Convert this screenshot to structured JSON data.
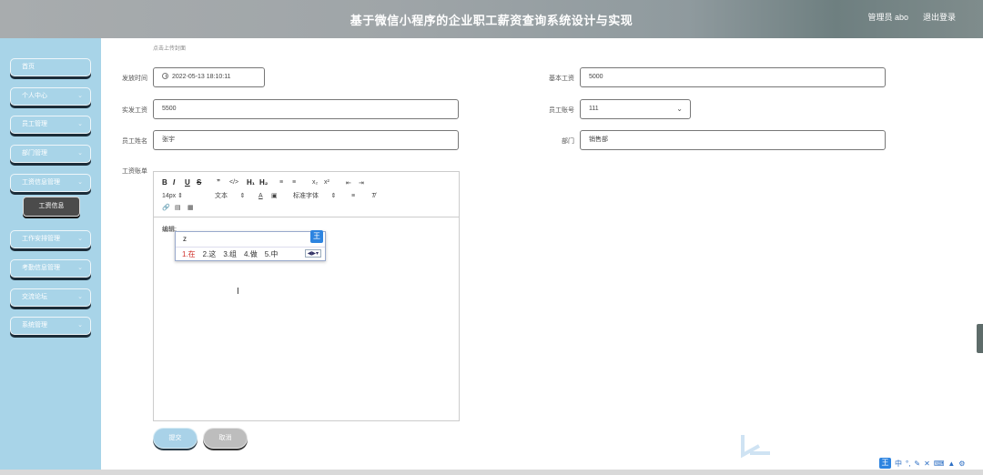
{
  "header": {
    "title": "基于微信小程序的企业职工薪资查询系统设计与实现",
    "admin_label": "管理员 abo",
    "logout_label": "退出登录"
  },
  "sidebar": {
    "items": [
      {
        "label": "首页",
        "has_chevron": false
      },
      {
        "label": "个人中心",
        "has_chevron": true
      },
      {
        "label": "员工管理",
        "has_chevron": true
      },
      {
        "label": "部门管理",
        "has_chevron": true
      },
      {
        "label": "工资信息管理",
        "has_chevron": true
      },
      {
        "label": "工作安排管理",
        "has_chevron": true
      },
      {
        "label": "考勤信息管理",
        "has_chevron": true
      },
      {
        "label": "交流论坛",
        "has_chevron": true
      },
      {
        "label": "系统管理",
        "has_chevron": true
      }
    ],
    "submenu": {
      "label": "工资信息"
    }
  },
  "form": {
    "upload_hint": "点击上传封面",
    "issue_time": {
      "label": "发放时间",
      "value": "2022-05-13 18:10:11"
    },
    "base_salary": {
      "label": "基本工资",
      "value": "5000"
    },
    "actual_salary": {
      "label": "实发工资",
      "value": "5500"
    },
    "employee_account": {
      "label": "员工账号",
      "value": "111"
    },
    "employee_name": {
      "label": "员工姓名",
      "value": "张宇"
    },
    "department": {
      "label": "部门",
      "value": "销售部"
    },
    "salary_detail": {
      "label": "工资账单"
    }
  },
  "editor": {
    "font_size": "14px",
    "paragraph": "文本",
    "font_family": "标准字体",
    "content": "编辑:"
  },
  "ime": {
    "composition": "z",
    "badge": "王",
    "candidates": [
      "1.在",
      "2.这",
      "3.组",
      "4.做",
      "5.中"
    ]
  },
  "buttons": {
    "submit": "提交",
    "cancel": "取消"
  },
  "tray": {
    "badge": "王",
    "lang": "中"
  },
  "colors": {
    "sidebar_bg": "#a8d4e8",
    "submenu_bg": "#4b4b4b",
    "ime_blue": "#2d84e0"
  }
}
